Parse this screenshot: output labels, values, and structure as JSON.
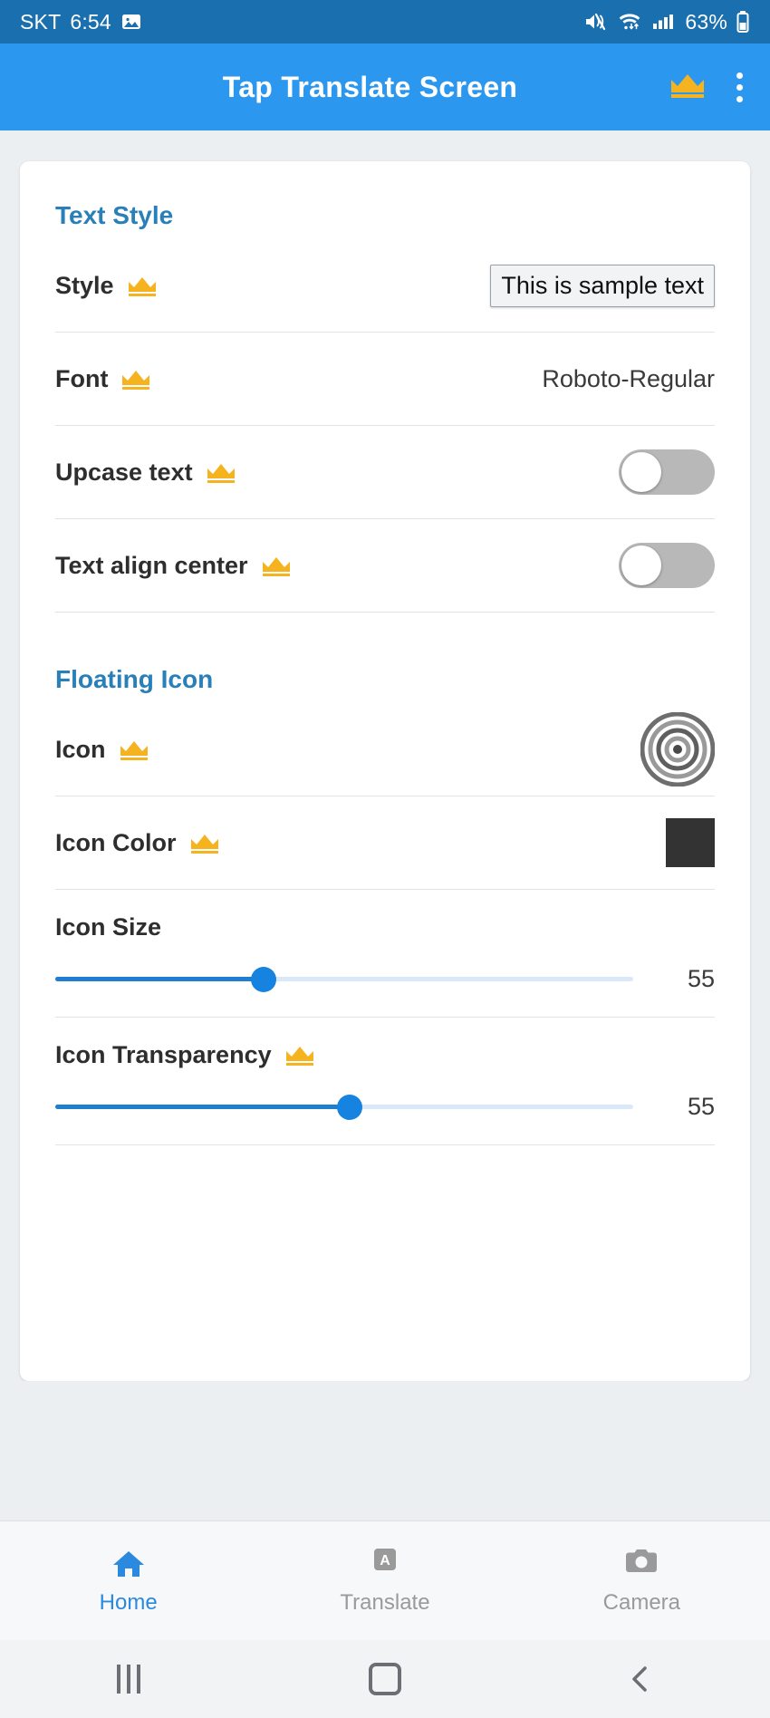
{
  "status_bar": {
    "carrier": "SKT",
    "time": "6:54",
    "image_icon": "image-icon",
    "mute_icon": "volume-mute-icon",
    "wifi_icon": "wifi-icon",
    "signal_icon": "cellular-signal-icon",
    "battery_percent": "63%",
    "battery_icon": "battery-icon",
    "bg_color": "#1a6fae"
  },
  "app_bar": {
    "title": "Tap Translate Screen",
    "premium_icon": "crown-icon",
    "overflow_icon": "more-vertical-icon",
    "bg_color": "#2b97ef",
    "crown_color": "#f5b41f"
  },
  "sections": [
    {
      "title": "Text Style",
      "rows": [
        {
          "label": "Style",
          "premium": true,
          "control": "sample-text",
          "value": "This is sample text"
        },
        {
          "label": "Font",
          "premium": true,
          "control": "value",
          "value": "Roboto-Regular"
        },
        {
          "label": "Upcase text",
          "premium": true,
          "control": "toggle",
          "value": "off"
        },
        {
          "label": "Text align center",
          "premium": true,
          "control": "toggle",
          "value": "off"
        }
      ]
    },
    {
      "title": "Floating Icon",
      "rows": [
        {
          "label": "Icon",
          "premium": true,
          "control": "bullseye-icon",
          "value": "target-icon"
        },
        {
          "label": "Icon Color",
          "premium": true,
          "control": "color-swatch",
          "value": "#333333"
        },
        {
          "label": "Icon Size",
          "premium": false,
          "control": "slider",
          "value": "55",
          "percent": 36
        },
        {
          "label": "Icon Transparency",
          "premium": true,
          "control": "slider",
          "value": "55",
          "percent": 51
        }
      ]
    }
  ],
  "bottom_nav": [
    {
      "label": "Home",
      "icon": "home-icon",
      "active": true
    },
    {
      "label": "Translate",
      "icon": "translate-a-icon",
      "active": false
    },
    {
      "label": "Camera",
      "icon": "camera-icon",
      "active": false
    }
  ],
  "system_nav": {
    "recents_icon": "recents-icon",
    "home_icon": "home-square-icon",
    "back_icon": "back-chevron-icon"
  },
  "colors": {
    "accent": "#2980b9",
    "app_bar": "#2b97ef",
    "crown": "#f5b41f",
    "slider": "#1683e0"
  }
}
